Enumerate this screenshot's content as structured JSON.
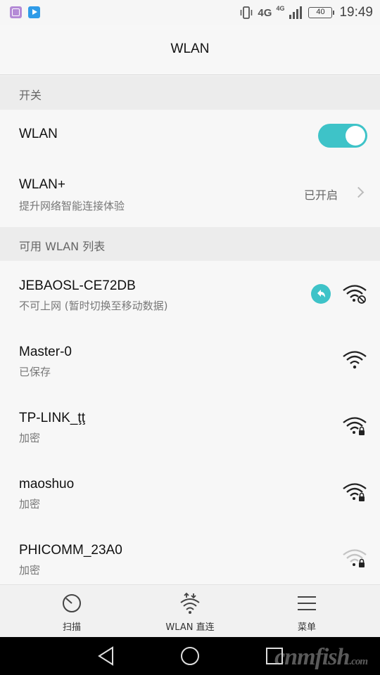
{
  "statusbar": {
    "network_1": "4G",
    "network_2": "4G",
    "battery": "40",
    "time": "19:49"
  },
  "header": {
    "title": "WLAN"
  },
  "sections": {
    "switch_header": "开关",
    "list_header": "可用 WLAN 列表"
  },
  "wlan_toggle": {
    "label": "WLAN",
    "state": "on"
  },
  "wlan_plus": {
    "label": "WLAN+",
    "sublabel": "提升网络智能连接体验",
    "value": "已开启"
  },
  "networks": [
    {
      "name": "JEBAOSL-CE72DB",
      "status": "不可上网 (暂时切换至移动数据)",
      "icon": "wifi-no-internet-icon"
    },
    {
      "name": "Master-0",
      "status": "已保存",
      "icon": "wifi-icon"
    },
    {
      "name": "TP-LINK_ţţ",
      "status": "加密",
      "icon": "wifi-locked-icon"
    },
    {
      "name": "maoshuo",
      "status": "加密",
      "icon": "wifi-locked-icon"
    },
    {
      "name": "PHICOMM_23A0",
      "status": "加密",
      "icon": "wifi-weak-locked-icon"
    }
  ],
  "bottom_tabs": [
    {
      "label": "扫描",
      "icon": "scan-icon"
    },
    {
      "label": "WLAN 直连",
      "icon": "wlan-direct-icon"
    },
    {
      "label": "菜单",
      "icon": "menu-icon"
    }
  ],
  "watermark": {
    "main": "cnmfish",
    "suffix": ".com"
  },
  "colors": {
    "accent": "#3ec3c8"
  }
}
